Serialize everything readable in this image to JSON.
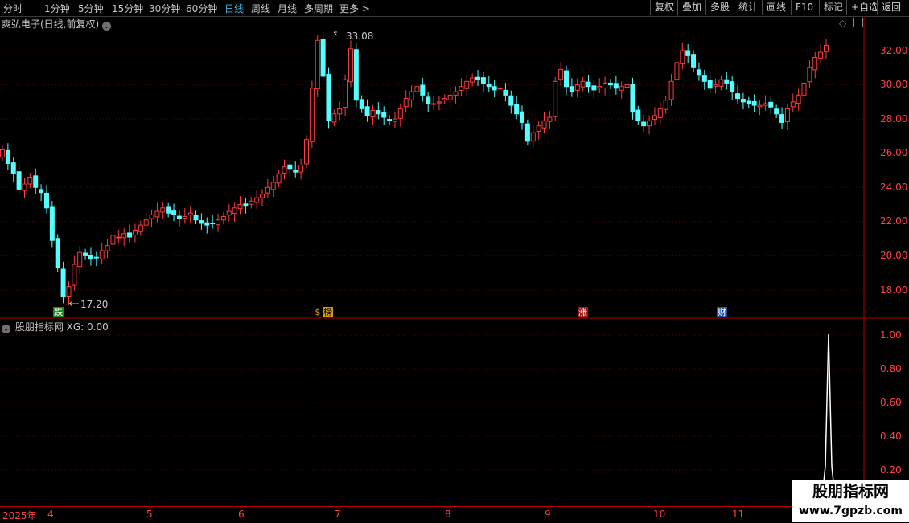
{
  "toolbar": {
    "periods": [
      "分时",
      "1分钟",
      "5分钟",
      "15分钟",
      "30分钟",
      "60分钟",
      "日线",
      "周线",
      "月线",
      "多周期",
      "更多 >"
    ],
    "active_period": "日线",
    "right_buttons": [
      "复权",
      "叠加",
      "多股",
      "统计",
      "画线",
      "F10",
      "标记",
      "+自选",
      "返回"
    ]
  },
  "kline": {
    "title": "爽弘电子(日线,前复权)",
    "high_label": "33.08",
    "low_label": "17.20",
    "yaxis": [
      "32.00",
      "30.00",
      "28.00",
      "26.00",
      "24.00",
      "22.00",
      "20.00",
      "18.00"
    ],
    "events": [
      {
        "label": "跌",
        "color": "#1fa11f"
      },
      {
        "label": "$",
        "color": "#c79a25"
      },
      {
        "label": "榜",
        "color": "#c79a25"
      },
      {
        "label": "涨",
        "color": "#c11a1a"
      },
      {
        "label": "财",
        "color": "#2457b8"
      }
    ]
  },
  "indicator": {
    "name": "股朋指标网",
    "value_text": "XG: 0.00",
    "yaxis": [
      "1.00",
      "0.80",
      "0.60",
      "0.40",
      "0.20"
    ]
  },
  "xaxis": [
    "2025年",
    "4",
    "5",
    "6",
    "7",
    "8",
    "9",
    "10",
    "11"
  ],
  "watermark": {
    "line1": "股朋指标网",
    "line2": "www.7gpzb.com"
  },
  "colors": {
    "up": "#ff3c3c",
    "down": "#54ffff",
    "axis": "#b00000",
    "grid": "#5a0000"
  },
  "chart_data": {
    "type": "candlestick",
    "series_close": [
      26.2,
      25.4,
      24.8,
      23.9,
      24.2,
      24.6,
      24.0,
      23.7,
      22.8,
      20.9,
      19.3,
      17.6,
      18.2,
      19.5,
      20.2,
      20.0,
      19.8,
      19.9,
      20.3,
      20.6,
      21.2,
      21.1,
      21.3,
      21.1,
      21.5,
      21.8,
      22.1,
      22.4,
      22.6,
      22.8,
      22.5,
      22.4,
      22.2,
      22.3,
      22.5,
      22.1,
      21.9,
      21.8,
      21.9,
      22.1,
      22.3,
      22.6,
      22.8,
      23.0,
      22.9,
      23.2,
      23.4,
      23.6,
      24.0,
      24.3,
      24.8,
      25.2,
      25.1,
      24.9,
      25.3,
      26.8,
      29.8,
      32.6,
      30.5,
      27.9,
      28.3,
      28.6,
      30.3,
      32.1,
      29.1,
      28.6,
      28.2,
      28.5,
      28.3,
      28.1,
      27.9,
      28.0,
      28.6,
      29.2,
      29.6,
      29.9,
      29.4,
      28.9,
      28.9,
      29.0,
      29.2,
      29.4,
      29.6,
      29.9,
      30.2,
      30.4,
      30.3,
      30.1,
      29.9,
      29.7,
      29.8,
      29.4,
      28.8,
      28.3,
      27.8,
      26.7,
      27.2,
      27.6,
      27.9,
      28.1,
      30.2,
      30.9,
      29.9,
      29.6,
      30.0,
      30.2,
      29.9,
      29.7,
      29.9,
      30.1,
      30.0,
      29.8,
      29.9,
      30.0,
      28.4,
      27.9,
      27.6,
      27.9,
      28.2,
      28.6,
      29.1,
      30.2,
      31.3,
      32.0,
      31.7,
      31.0,
      30.6,
      30.2,
      29.8,
      30.0,
      30.3,
      30.1,
      29.6,
      29.2,
      29.0,
      28.9,
      28.8,
      28.8,
      28.9,
      28.7,
      28.3,
      27.8,
      28.6,
      29.0,
      29.4,
      30.1,
      31.0,
      31.6,
      31.9,
      32.3
    ],
    "y_range": [
      16.3,
      33.5
    ],
    "indicator_series": "XG"
  }
}
